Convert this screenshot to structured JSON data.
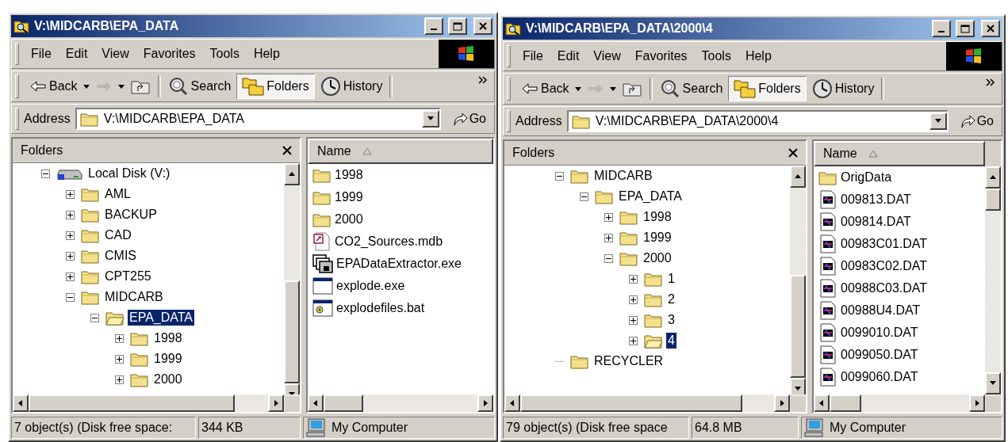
{
  "windows": [
    {
      "title": "V:\\MIDCARB\\EPA_DATA",
      "menu": [
        "File",
        "Edit",
        "View",
        "Favorites",
        "Tools",
        "Help"
      ],
      "toolbar": [
        {
          "kind": "back",
          "label": "Back",
          "selected": false,
          "disabled": false
        },
        {
          "kind": "forward",
          "selected": false,
          "disabled": true
        },
        {
          "kind": "up",
          "selected": false,
          "disabled": false
        },
        {
          "kind": "search",
          "label": "Search",
          "selected": false,
          "disabled": false
        },
        {
          "kind": "folders",
          "label": "Folders",
          "selected": true,
          "disabled": false
        },
        {
          "kind": "history",
          "label": "History",
          "selected": false,
          "disabled": false
        }
      ],
      "address": {
        "label": "Address",
        "value": "V:\\MIDCARB\\EPA_DATA",
        "go": "Go"
      },
      "folders_pane": {
        "title": "Folders",
        "tree": [
          {
            "name": "Local Disk (V:)",
            "kind": "drive",
            "expandable": true,
            "expanded": true,
            "selected": false,
            "children": [
              {
                "name": "AML",
                "kind": "folder",
                "expandable": true,
                "expanded": false,
                "selected": false
              },
              {
                "name": "BACKUP",
                "kind": "folder",
                "expandable": true,
                "expanded": false,
                "selected": false
              },
              {
                "name": "CAD",
                "kind": "folder",
                "expandable": true,
                "expanded": false,
                "selected": false
              },
              {
                "name": "CMIS",
                "kind": "folder",
                "expandable": true,
                "expanded": false,
                "selected": false
              },
              {
                "name": "CPT255",
                "kind": "folder",
                "expandable": true,
                "expanded": false,
                "selected": false
              },
              {
                "name": "MIDCARB",
                "kind": "folder",
                "expandable": true,
                "expanded": true,
                "selected": false,
                "children": [
                  {
                    "name": "EPA_DATA",
                    "kind": "folder",
                    "expandable": true,
                    "expanded": true,
                    "selected": true,
                    "children": [
                      {
                        "name": "1998",
                        "kind": "folder",
                        "expandable": true,
                        "expanded": false,
                        "selected": false
                      },
                      {
                        "name": "1999",
                        "kind": "folder",
                        "expandable": true,
                        "expanded": false,
                        "selected": false
                      },
                      {
                        "name": "2000",
                        "kind": "folder",
                        "expandable": true,
                        "expanded": false,
                        "selected": false
                      }
                    ]
                  }
                ]
              }
            ]
          }
        ]
      },
      "file_list": {
        "column": "Name",
        "scrollable": false,
        "files": [
          {
            "name": "1998",
            "kind": "folder"
          },
          {
            "name": "1999",
            "kind": "folder"
          },
          {
            "name": "2000",
            "kind": "folder"
          },
          {
            "name": "CO2_Sources.mdb",
            "kind": "database"
          },
          {
            "name": "EPADataExtractor.exe",
            "kind": "program"
          },
          {
            "name": "explode.exe",
            "kind": "window"
          },
          {
            "name": "explodefiles.bat",
            "kind": "batch"
          }
        ]
      },
      "status_bar": {
        "objects": "7 object(s) (Disk free space:",
        "size": "344 KB",
        "zone": "My Computer"
      }
    },
    {
      "title": "V:\\MIDCARB\\EPA_DATA\\2000\\4",
      "menu": [
        "File",
        "Edit",
        "View",
        "Favorites",
        "Tools",
        "Help"
      ],
      "toolbar": [
        {
          "kind": "back",
          "label": "Back",
          "selected": false,
          "disabled": false
        },
        {
          "kind": "forward",
          "selected": false,
          "disabled": true
        },
        {
          "kind": "up",
          "selected": false,
          "disabled": false
        },
        {
          "kind": "search",
          "label": "Search",
          "selected": false,
          "disabled": false
        },
        {
          "kind": "folders",
          "label": "Folders",
          "selected": true,
          "disabled": false
        },
        {
          "kind": "history",
          "label": "History",
          "selected": false,
          "disabled": false
        }
      ],
      "address": {
        "label": "Address",
        "value": "V:\\MIDCARB\\EPA_DATA\\2000\\4",
        "go": "Go"
      },
      "folders_pane": {
        "title": "Folders",
        "tree": [
          {
            "name": "MIDCARB",
            "kind": "folder",
            "expandable": true,
            "expanded": true,
            "selected": false,
            "children": [
              {
                "name": "EPA_DATA",
                "kind": "folder",
                "expandable": true,
                "expanded": true,
                "selected": false,
                "children": [
                  {
                    "name": "1998",
                    "kind": "folder",
                    "expandable": true,
                    "expanded": false,
                    "selected": false
                  },
                  {
                    "name": "1999",
                    "kind": "folder",
                    "expandable": true,
                    "expanded": false,
                    "selected": false
                  },
                  {
                    "name": "2000",
                    "kind": "folder",
                    "expandable": true,
                    "expanded": true,
                    "selected": false,
                    "children": [
                      {
                        "name": "1",
                        "kind": "folder",
                        "expandable": true,
                        "expanded": false,
                        "selected": false
                      },
                      {
                        "name": "2",
                        "kind": "folder",
                        "expandable": true,
                        "expanded": false,
                        "selected": false
                      },
                      {
                        "name": "3",
                        "kind": "folder",
                        "expandable": true,
                        "expanded": false,
                        "selected": false
                      },
                      {
                        "name": "4",
                        "kind": "folder",
                        "expandable": true,
                        "expanded": false,
                        "selected": true
                      }
                    ]
                  }
                ]
              }
            ]
          },
          {
            "name": "RECYCLER",
            "kind": "folder",
            "expandable": false,
            "expanded": false,
            "selected": false
          }
        ]
      },
      "file_list": {
        "column": "Name",
        "scrollable": true,
        "files": [
          {
            "name": "OrigData",
            "kind": "folder"
          },
          {
            "name": "009813.DAT",
            "kind": "data"
          },
          {
            "name": "009814.DAT",
            "kind": "data"
          },
          {
            "name": "00983C01.DAT",
            "kind": "data"
          },
          {
            "name": "00983C02.DAT",
            "kind": "data"
          },
          {
            "name": "00988C03.DAT",
            "kind": "data"
          },
          {
            "name": "00988U4.DAT",
            "kind": "data"
          },
          {
            "name": "0099010.DAT",
            "kind": "data"
          },
          {
            "name": "0099050.DAT",
            "kind": "data"
          },
          {
            "name": "0099060.DAT",
            "kind": "data"
          }
        ]
      },
      "status_bar": {
        "objects": "79 object(s) (Disk free space",
        "size": "64.8 MB",
        "zone": "My Computer"
      }
    }
  ]
}
